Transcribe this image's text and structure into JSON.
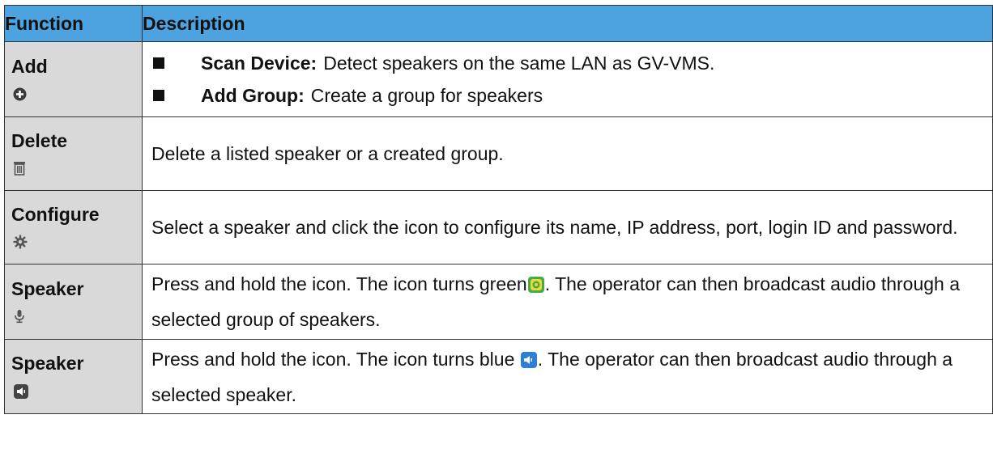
{
  "table": {
    "headers": {
      "function": "Function",
      "description": "Description"
    },
    "rows": {
      "add": {
        "function": "Add",
        "icon": "add-circle-icon",
        "items": [
          {
            "bold": "Scan Device:",
            "text": "Detect speakers on the same LAN as GV-VMS."
          },
          {
            "bold": "Add Group:",
            "text": "Create a group for speakers"
          }
        ]
      },
      "delete": {
        "function": "Delete",
        "icon": "trash-icon",
        "description": "Delete a listed speaker or a created group."
      },
      "configure": {
        "function": "Configure",
        "icon": "gear-icon",
        "description": "Select a speaker and click the icon to configure its name, IP address, port, login ID and password."
      },
      "speaker_group": {
        "function": "Speaker",
        "icon": "microphone-icon",
        "desc_a": "Press and hold the icon. The icon turns green",
        "desc_b": ". The operator can then broadcast audio through a selected group of speakers."
      },
      "speaker_single": {
        "function": "Speaker",
        "icon": "loudspeaker-icon",
        "desc_a": "Press and hold the icon. The icon turns blue ",
        "desc_b": ". The operator can then broadcast audio through a selected speaker."
      }
    }
  },
  "colors": {
    "header_bg": "#4da3df",
    "function_bg": "#d9d9d9",
    "border": "#333333",
    "green_icon": "#3cb043",
    "blue_icon": "#2f7fd6"
  }
}
